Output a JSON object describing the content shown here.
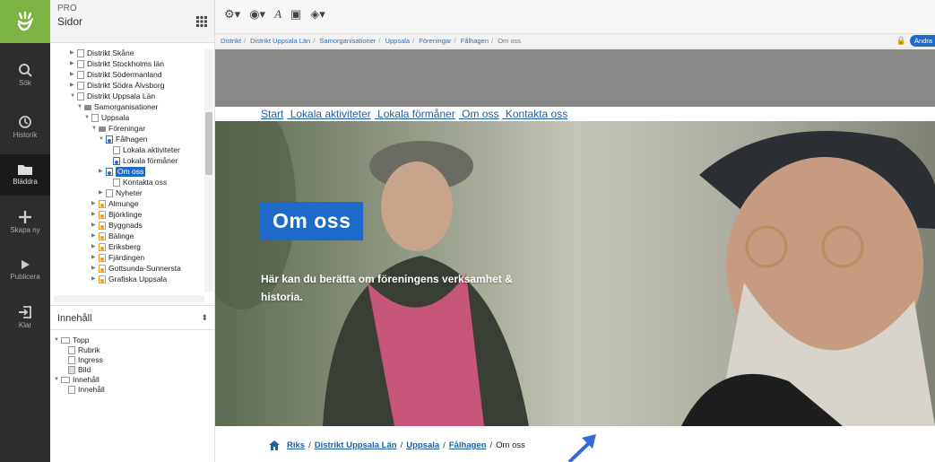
{
  "app": {
    "product": "PRO",
    "section": "Sidor"
  },
  "colors": {
    "brand_green": "#7cb342",
    "accent_blue": "#1e6ac8",
    "rail": "#2d2d2d"
  },
  "rail": [
    {
      "label": "Sök",
      "icon": "search-icon"
    },
    {
      "label": "Historik",
      "icon": "history-icon"
    },
    {
      "label": "Bläddra",
      "icon": "folder-icon"
    },
    {
      "label": "Skapa ny",
      "icon": "plus-icon"
    },
    {
      "label": "Publicera",
      "icon": "play-icon"
    },
    {
      "label": "Klar",
      "icon": "exit-icon"
    }
  ],
  "tree": [
    {
      "label": "Distrikt Skåne",
      "icon": "page"
    },
    {
      "label": "Distrikt Stockholms län",
      "icon": "page"
    },
    {
      "label": "Distrikt Södermanland",
      "icon": "page"
    },
    {
      "label": "Distrikt Södra Älvsborg",
      "icon": "page"
    },
    {
      "label": "Distrikt Uppsala Län",
      "icon": "page"
    },
    {
      "label": "Samorganisationer",
      "icon": "folder"
    },
    {
      "label": "Uppsala",
      "icon": "page"
    },
    {
      "label": "Föreningar",
      "icon": "folder"
    },
    {
      "label": "Fålhagen",
      "icon": "blue"
    },
    {
      "label": "Lokala aktiviteter",
      "icon": "page"
    },
    {
      "label": "Lokala förmåner",
      "icon": "blue"
    },
    {
      "label": "Om oss",
      "icon": "blue"
    },
    {
      "label": "Kontakta oss",
      "icon": "page"
    },
    {
      "label": "Nyheter",
      "icon": "page"
    },
    {
      "label": "Almunge",
      "icon": "org"
    },
    {
      "label": "Björklinge",
      "icon": "org"
    },
    {
      "label": "Byggnads",
      "icon": "org"
    },
    {
      "label": "Bälinge",
      "icon": "org"
    },
    {
      "label": "Eriksberg",
      "icon": "org"
    },
    {
      "label": "Fjärdingen",
      "icon": "org"
    },
    {
      "label": "Gottsunda-Sunnersta",
      "icon": "org"
    },
    {
      "label": "Grafiska Uppsala",
      "icon": "org"
    }
  ],
  "content_select": {
    "value": "Innehåll"
  },
  "content_tree": [
    {
      "label": "Topp"
    },
    {
      "label": "Rubrik"
    },
    {
      "label": "Ingress"
    },
    {
      "label": "Bild"
    },
    {
      "label": "Innehåll"
    },
    {
      "label": "Innehåll"
    }
  ],
  "breadcrumb": [
    "Distrikt",
    "Distrikt Uppsala Län",
    "Samorganisationer",
    "Uppsala",
    "Föreningar",
    "Fålhagen",
    "Om oss"
  ],
  "lock_button": "Ändra",
  "topnav": [
    "Start",
    "Lokala aktiviteter",
    "Lokala förmåner",
    "Om oss",
    "Kontakta oss"
  ],
  "hero": {
    "title": "Om oss",
    "lead": "Här kan du berätta om föreningens verksamhet & historia."
  },
  "bottom_breadcrumb": {
    "links": [
      "Riks",
      "Distrikt Uppsala Län",
      "Uppsala",
      "Fålhagen"
    ],
    "current": "Om oss"
  }
}
